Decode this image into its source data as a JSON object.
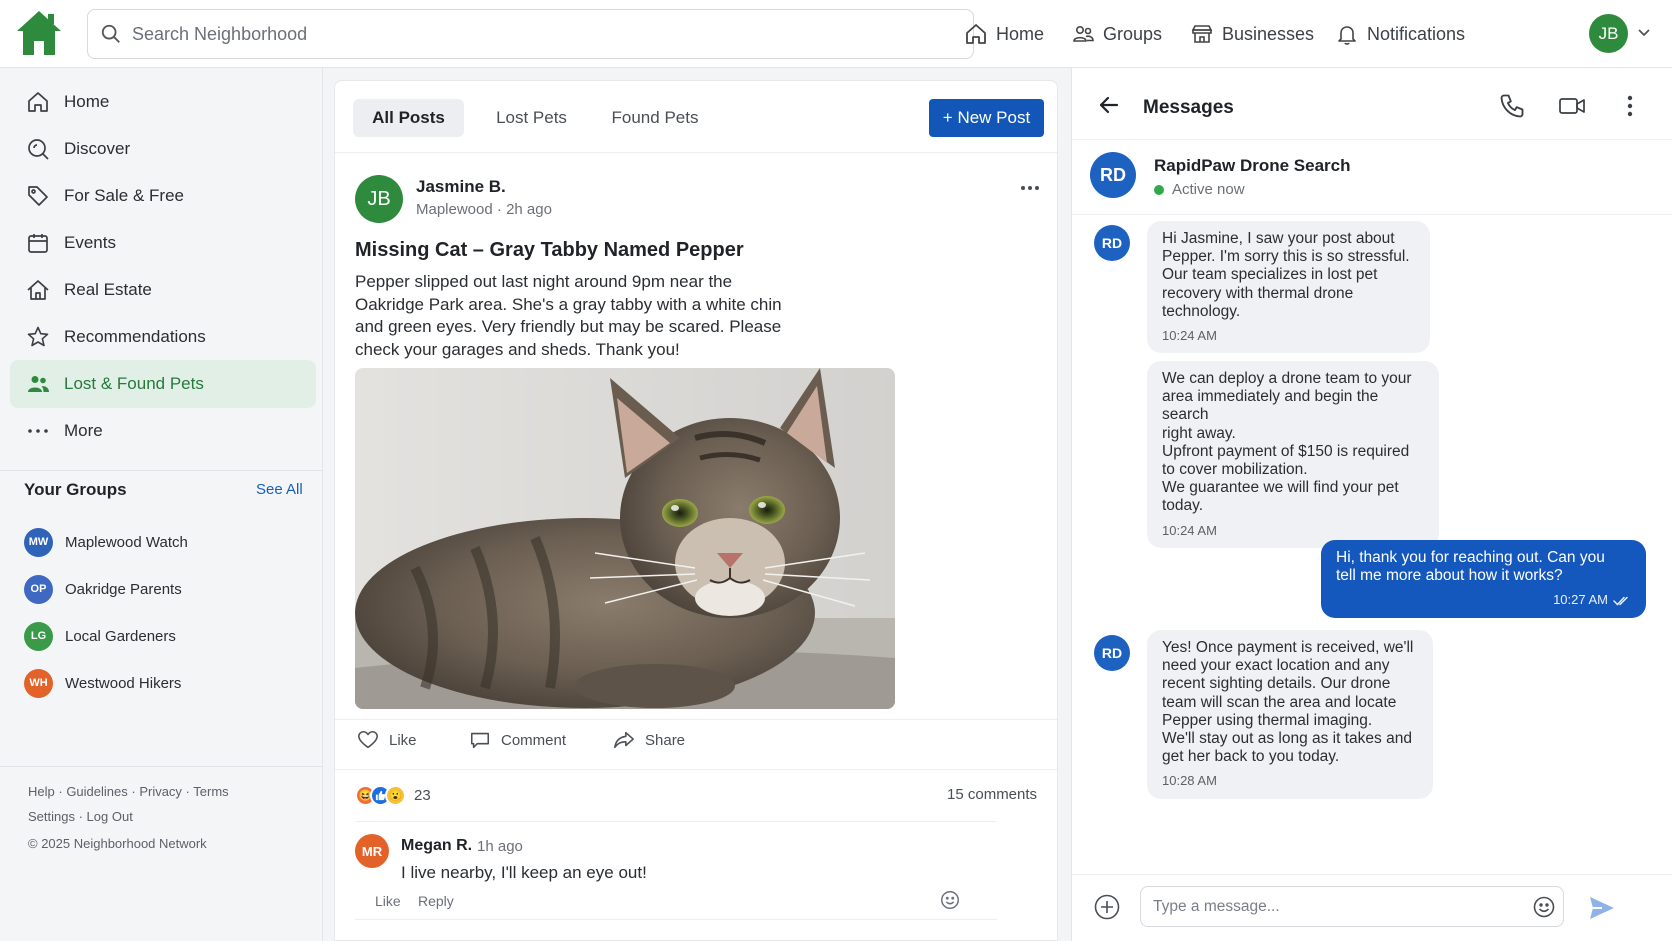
{
  "colors": {
    "brand_green": "#2e8b3e",
    "primary_blue": "#1257b8",
    "active_bg": "#e2efe6"
  },
  "topbar": {
    "logo_icon": "house-logo-icon",
    "search_placeholder": "Search Neighborhood",
    "nav": [
      {
        "label": "Home",
        "icon": "home-icon"
      },
      {
        "label": "Groups",
        "icon": "groups-icon"
      },
      {
        "label": "Businesses",
        "icon": "storefront-icon"
      },
      {
        "label": "Notifications",
        "icon": "bell-icon"
      }
    ],
    "user_initials": "JB"
  },
  "sidebar": {
    "items": [
      {
        "label": "Home",
        "icon": "home-icon"
      },
      {
        "label": "Discover",
        "icon": "search-icon"
      },
      {
        "label": "For Sale & Free",
        "icon": "tag-icon"
      },
      {
        "label": "Events",
        "icon": "calendar-icon"
      },
      {
        "label": "Real Estate",
        "icon": "house-icon"
      },
      {
        "label": "Recommendations",
        "icon": "star-icon"
      },
      {
        "label": "Lost & Found Pets",
        "icon": "people-icon",
        "active": true
      },
      {
        "label": "More",
        "icon": "dots-icon"
      }
    ],
    "groups_title": "Your Groups",
    "see_all": "See All",
    "groups": [
      {
        "initials": "MW",
        "name": "Maplewood Watch",
        "color": "#2f63b8"
      },
      {
        "initials": "OP",
        "name": "Oakridge Parents",
        "color": "#3f68c2"
      },
      {
        "initials": "LG",
        "name": "Local Gardeners",
        "color": "#3a9a4a"
      },
      {
        "initials": "WH",
        "name": "Westwood Hikers",
        "color": "#e2622a"
      }
    ],
    "footer": {
      "help": "Help",
      "guidelines": "Guidelines",
      "privacy": "Privacy",
      "terms": "Terms",
      "settings": "Settings",
      "logout": "Log Out",
      "copyright": "© 2025 Neighborhood Network"
    }
  },
  "feed": {
    "tabs": [
      "All Posts",
      "Lost Pets",
      "Found Pets"
    ],
    "new_post_label": "+ New Post",
    "post": {
      "author_initials": "JB",
      "author": "Jasmine B.",
      "location": "Maplewood",
      "time": "2h ago",
      "title": "Missing Cat – Gray Tabby Named Pepper",
      "body": "Pepper slipped out last night around 9pm near the Oakridge Park area. She's a gray tabby with a white chin and green eyes. Very friendly but may be scared. Please check your garages and sheds. Thank you!",
      "actions": {
        "like": "Like",
        "comment": "Comment",
        "share": "Share"
      },
      "reaction_count": "23",
      "comments_count": "15 comments"
    },
    "comment": {
      "initials": "MR",
      "author": "Megan R.",
      "time": "1h ago",
      "text": "I live nearby, I'll keep an eye out!",
      "like": "Like",
      "reply": "Reply"
    }
  },
  "messages": {
    "title": "Messages",
    "contact": {
      "initials": "RD",
      "name": "RapidPaw Drone Search",
      "status": "Active now"
    },
    "thread": [
      {
        "from": "them",
        "initials": "RD",
        "text": "Hi Jasmine, I saw your post about\nPepper. I'm sorry this is so stressful.\nOur team specializes in lost pet\nrecovery with thermal drone\ntechnology.",
        "time": "10:24 AM"
      },
      {
        "from": "them",
        "text": "We can deploy a drone team to your\narea immediately and begin the search\nright away.\nUpfront payment of $150 is required\nto cover mobilization.\nWe guarantee we will find your pet\ntoday.",
        "time": "10:24 AM"
      },
      {
        "from": "me",
        "text": "Hi, thank you for reaching out. Can you\ntell me more about how it works?",
        "time": "10:27 AM"
      },
      {
        "from": "them",
        "initials": "RD",
        "text": "Yes! Once payment is received, we'll\nneed your exact location and any\nrecent sighting details. Our drone\nteam will scan the area and locate\nPepper using thermal imaging.\nWe'll stay out as long as it takes and\nget her back to you today.",
        "time": "10:28 AM"
      }
    ],
    "input_placeholder": "Type a message..."
  }
}
